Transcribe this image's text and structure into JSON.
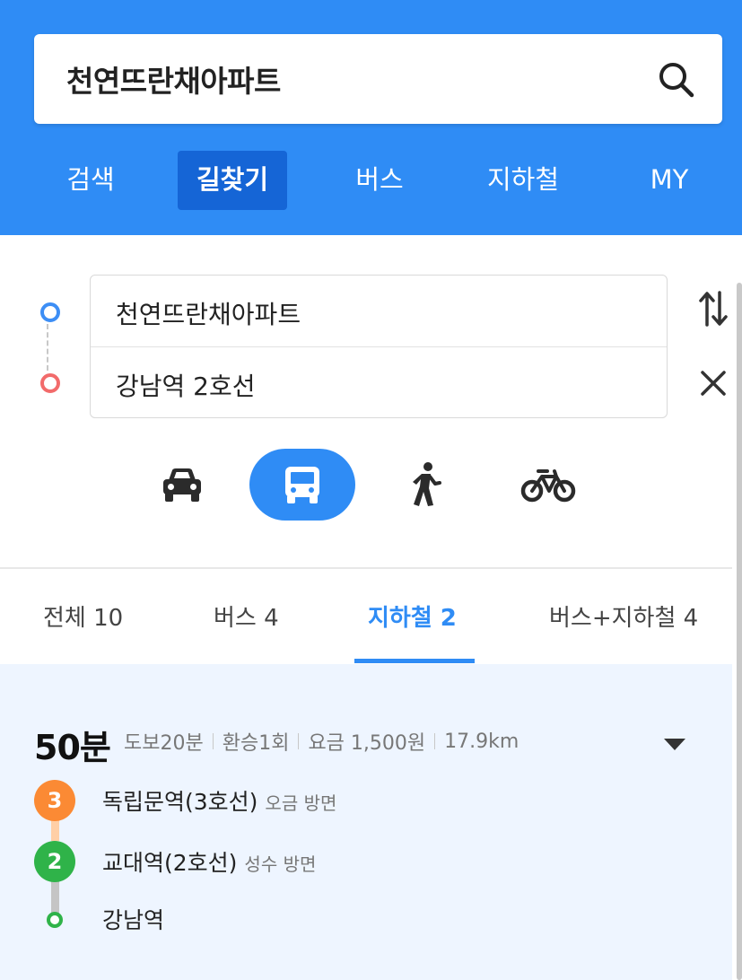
{
  "search": {
    "query": "천연뜨란채아파트",
    "icon": "search-icon"
  },
  "nav_tabs": [
    {
      "label": "검색",
      "active": false
    },
    {
      "label": "길찾기",
      "active": true
    },
    {
      "label": "버스",
      "active": false
    },
    {
      "label": "지하철",
      "active": false
    },
    {
      "label": "MY",
      "active": false
    }
  ],
  "route": {
    "from": "천연뜨란채아파트",
    "to": "강남역 2호선"
  },
  "modes": [
    {
      "name": "car",
      "active": false
    },
    {
      "name": "bus",
      "active": true
    },
    {
      "name": "walk",
      "active": false
    },
    {
      "name": "bike",
      "active": false
    }
  ],
  "result_tabs": [
    {
      "label": "전체 10",
      "active": false
    },
    {
      "label": "버스 4",
      "active": false
    },
    {
      "label": "지하철 2",
      "active": true
    },
    {
      "label": "버스+지하철 4",
      "active": false
    }
  ],
  "result": {
    "duration": "50분",
    "walk": "도보20분",
    "transfer": "환승1회",
    "fare": "요금 1,500원",
    "distance": "17.9km",
    "steps": [
      {
        "badge": "3",
        "station": "독립문역(3호선)",
        "direction": "오금 방면"
      },
      {
        "badge": "2",
        "station": "교대역(2호선)",
        "direction": "성수 방면"
      },
      {
        "station": "강남역"
      }
    ]
  },
  "colors": {
    "accent": "#2f8cf5",
    "active_tab_bg": "#1565d6",
    "line3": "#fb8a34",
    "line2": "#2fb349",
    "start_dot": "#3d8ef5",
    "end_dot": "#f26b6b",
    "result_bg": "#eef5ff"
  }
}
